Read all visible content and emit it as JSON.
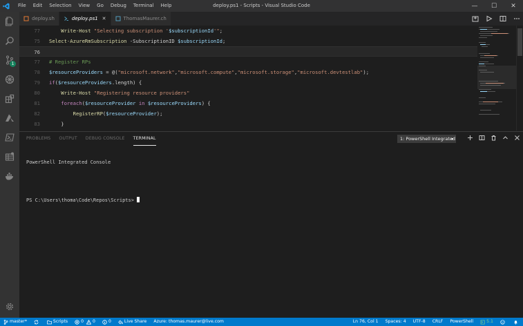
{
  "window": {
    "title": "deploy.ps1 - Scripts - Visual Studio Code",
    "controls": {
      "minimize": "—",
      "maximize": "☐",
      "close": "✕"
    }
  },
  "menu": [
    "File",
    "Edit",
    "Selection",
    "View",
    "Go",
    "Debug",
    "Terminal",
    "Help"
  ],
  "activity": {
    "items": [
      "explorer-icon",
      "search-icon",
      "source-control-icon",
      "debug-icon",
      "extensions-icon",
      "azure-icon",
      "powershell-icon",
      "azure-storage-icon",
      "docker-icon"
    ],
    "scm_badge": "1",
    "settings": "gear-icon"
  },
  "tabs": [
    {
      "label": "deploy.sh",
      "active": false,
      "close": ""
    },
    {
      "label": "deploy.ps1",
      "active": true,
      "close": "✕"
    },
    {
      "label": "ThomasMaurer.ch",
      "active": false,
      "close": ""
    }
  ],
  "editor": {
    "lines": [
      {
        "num": "77",
        "tokens": [
          [
            "fn",
            "    Write-Host "
          ],
          [
            "str",
            "\"Selecting subscription '"
          ],
          [
            "var",
            "$subscriptionId"
          ],
          [
            "str",
            "'\""
          ],
          [
            "plain",
            ";"
          ]
        ]
      },
      {
        "num": "75",
        "tokens": [
          [
            "fn",
            "Select-AzureRmSubscription"
          ],
          [
            "plain",
            " -SubscriptionID "
          ],
          [
            "var",
            "$subscriptionId"
          ],
          [
            "plain",
            ";"
          ]
        ]
      },
      {
        "num": "76",
        "current": true,
        "tokens": []
      },
      {
        "num": "77",
        "tokens": [
          [
            "cmt",
            "# Register RPs"
          ]
        ]
      },
      {
        "num": "78",
        "tokens": [
          [
            "var",
            "$resourceProviders"
          ],
          [
            "plain",
            " = @("
          ],
          [
            "str",
            "\"microsoft.network\""
          ],
          [
            "plain",
            ","
          ],
          [
            "str",
            "\"microsoft.compute\""
          ],
          [
            "plain",
            ","
          ],
          [
            "str",
            "\"microsoft.storage\""
          ],
          [
            "plain",
            ","
          ],
          [
            "str",
            "\"microsoft.devtestlab\""
          ],
          [
            "plain",
            ");"
          ]
        ]
      },
      {
        "num": "79",
        "tokens": [
          [
            "kw",
            "if"
          ],
          [
            "plain",
            "("
          ],
          [
            "var",
            "$resourceProviders"
          ],
          [
            "plain",
            ".length) {"
          ]
        ]
      },
      {
        "num": "80",
        "tokens": [
          [
            "fn",
            "    Write-Host "
          ],
          [
            "str",
            "\"Registering resource providers\""
          ]
        ]
      },
      {
        "num": "81",
        "tokens": [
          [
            "kw",
            "    foreach"
          ],
          [
            "plain",
            "("
          ],
          [
            "var",
            "$resourceProvider"
          ],
          [
            "kw",
            " in "
          ],
          [
            "var",
            "$resourceProviders"
          ],
          [
            "plain",
            ") {"
          ]
        ]
      },
      {
        "num": "82",
        "tokens": [
          [
            "fn",
            "        RegisterRP"
          ],
          [
            "plain",
            "("
          ],
          [
            "var",
            "$resourceProvider"
          ],
          [
            "plain",
            ");"
          ]
        ]
      },
      {
        "num": "83",
        "tokens": [
          [
            "plain",
            "    }"
          ]
        ]
      }
    ]
  },
  "panel": {
    "tabs": [
      {
        "label": "PROBLEMS",
        "active": false
      },
      {
        "label": "OUTPUT",
        "active": false
      },
      {
        "label": "DEBUG CONSOLE",
        "active": false
      },
      {
        "label": "TERMINAL",
        "active": true
      }
    ],
    "terminal_select": "1: PowerShell Integrated Console",
    "terminal_lines": [
      "PowerShell Integrated Console",
      "",
      "PS C:\\Users\\thoma\\Code\\Repos\\Scripts> "
    ]
  },
  "status": {
    "branch": "master*",
    "sync": "",
    "folder": "Scripts",
    "problems_errors": "0",
    "problems_warnings": "0",
    "alerts": "0",
    "live_share": "Live Share",
    "azure_account": "Azure: thomas.maurer@live.com",
    "ln_col": "Ln 76, Col 1",
    "spaces": "Spaces: 4",
    "encoding": "UTF-8",
    "eol": "CRLF",
    "language": "PowerShell",
    "ps_version": "5.1",
    "colors": {
      "bar": "#007acc",
      "ps_version": "#89d185"
    }
  }
}
